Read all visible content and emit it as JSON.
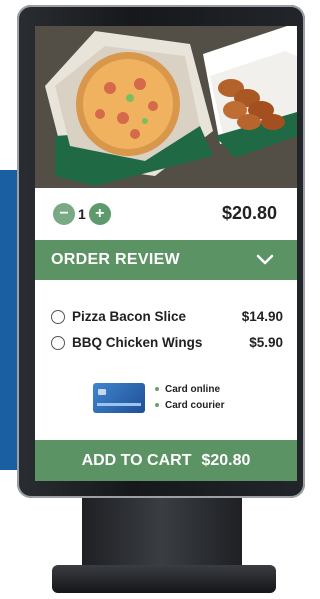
{
  "quantity": {
    "minus_symbol": "−",
    "value": "1",
    "plus_symbol": "+",
    "price": "$20.80"
  },
  "review": {
    "title": "ORDER REVIEW",
    "chevron_icon": "chevron-down-icon"
  },
  "items": [
    {
      "name": "Pizza Bacon Slice",
      "price": "$14.90"
    },
    {
      "name": "BBQ Chicken Wings",
      "price": "$5.90"
    }
  ],
  "payment": {
    "card_icon": "credit-card-icon",
    "options": [
      "Card online",
      "Card courier"
    ]
  },
  "cart": {
    "label": "ADD TO CART",
    "total": "$20.80"
  },
  "colors": {
    "accent_green": "#5b9364",
    "panel_blue": "#1b5fa3"
  }
}
